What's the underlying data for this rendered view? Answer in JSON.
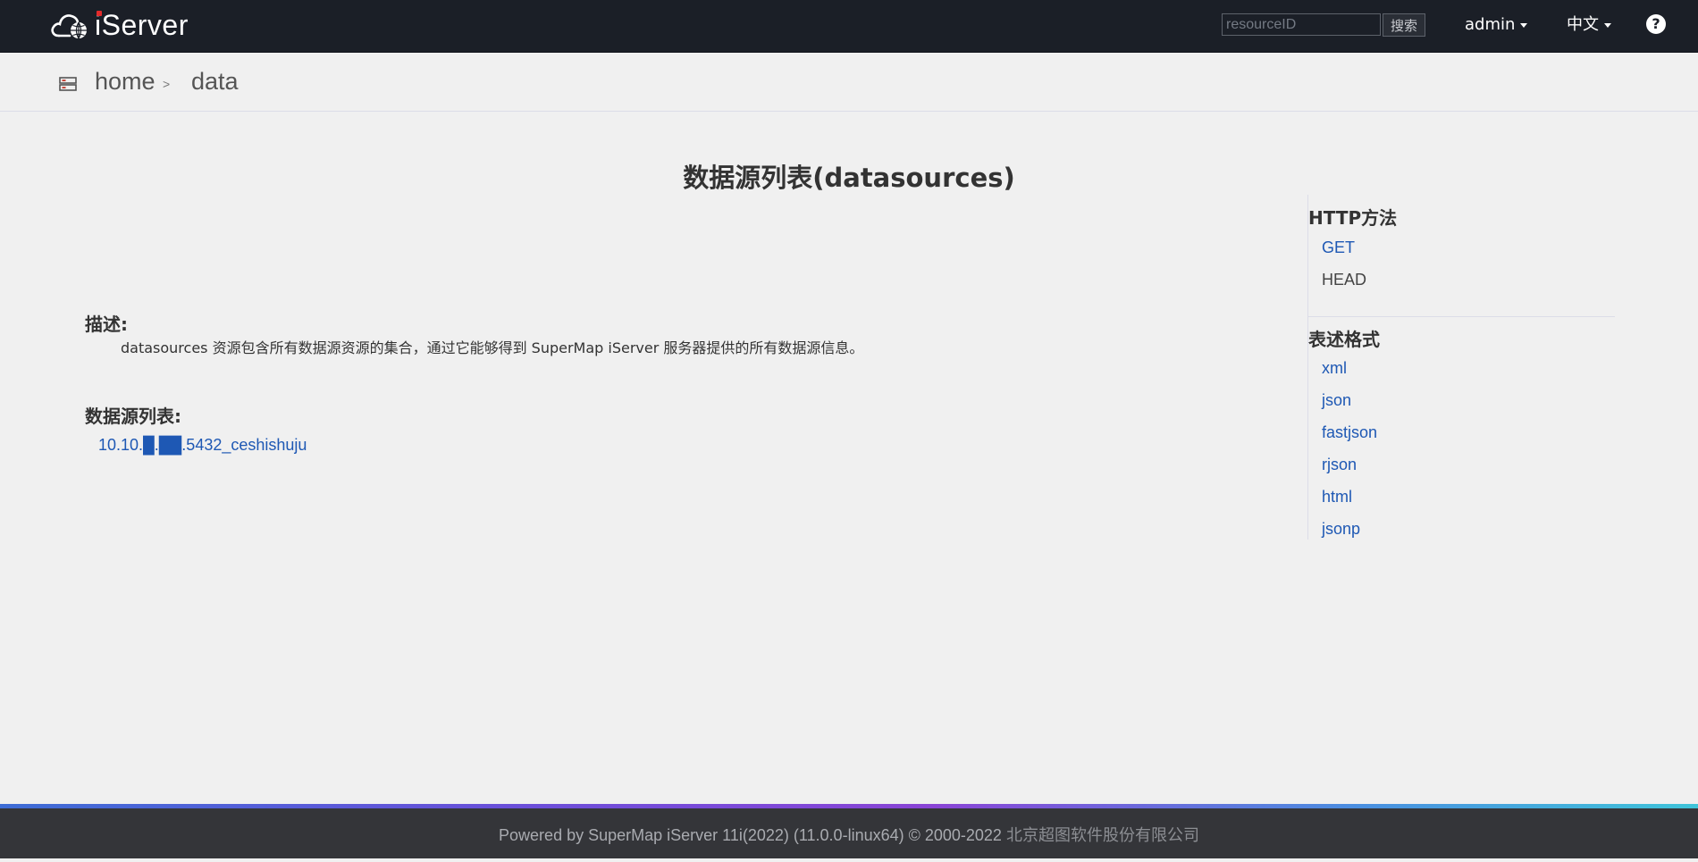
{
  "header": {
    "logo_text": "iServer",
    "search": {
      "placeholder": "resourceID",
      "value": "",
      "button_label": "搜索"
    },
    "user_menu_label": "admin",
    "language_menu_label": "中文",
    "help_label": "?"
  },
  "breadcrumb": {
    "home_label": "home",
    "separator": ">",
    "current_label": "data"
  },
  "main": {
    "title": "数据源列表(datasources)",
    "description": {
      "heading": "描述:",
      "text": "datasources 资源包含所有数据源资源的集合，通过它能够得到 SuperMap iServer 服务器提供的所有数据源信息。"
    },
    "datasource_list": {
      "heading": "数据源列表:",
      "items": [
        {
          "label": "10.10.█.██.5432_ceshishuju"
        }
      ]
    }
  },
  "side_panel": {
    "http_methods_heading": "HTTP方法",
    "http_methods": [
      {
        "label": "GET",
        "is_link": true
      },
      {
        "label": "HEAD",
        "is_link": false
      }
    ],
    "formats_heading": "表述格式",
    "formats": [
      {
        "label": "xml"
      },
      {
        "label": "json"
      },
      {
        "label": "fastjson"
      },
      {
        "label": "rjson"
      },
      {
        "label": "html"
      },
      {
        "label": "jsonp"
      }
    ]
  },
  "footer": {
    "powered_by": "Powered by SuperMap iServer 11i(2022) (11.0.0-linux64) © 2000-2022",
    "company": "北京超图软件股份有限公司"
  },
  "colors": {
    "topbar_bg": "#1b1f27",
    "page_bg": "#f0f0f0",
    "link": "#1e58b4",
    "footer_bg": "#343539",
    "logo_accent": "#e32b2b"
  }
}
